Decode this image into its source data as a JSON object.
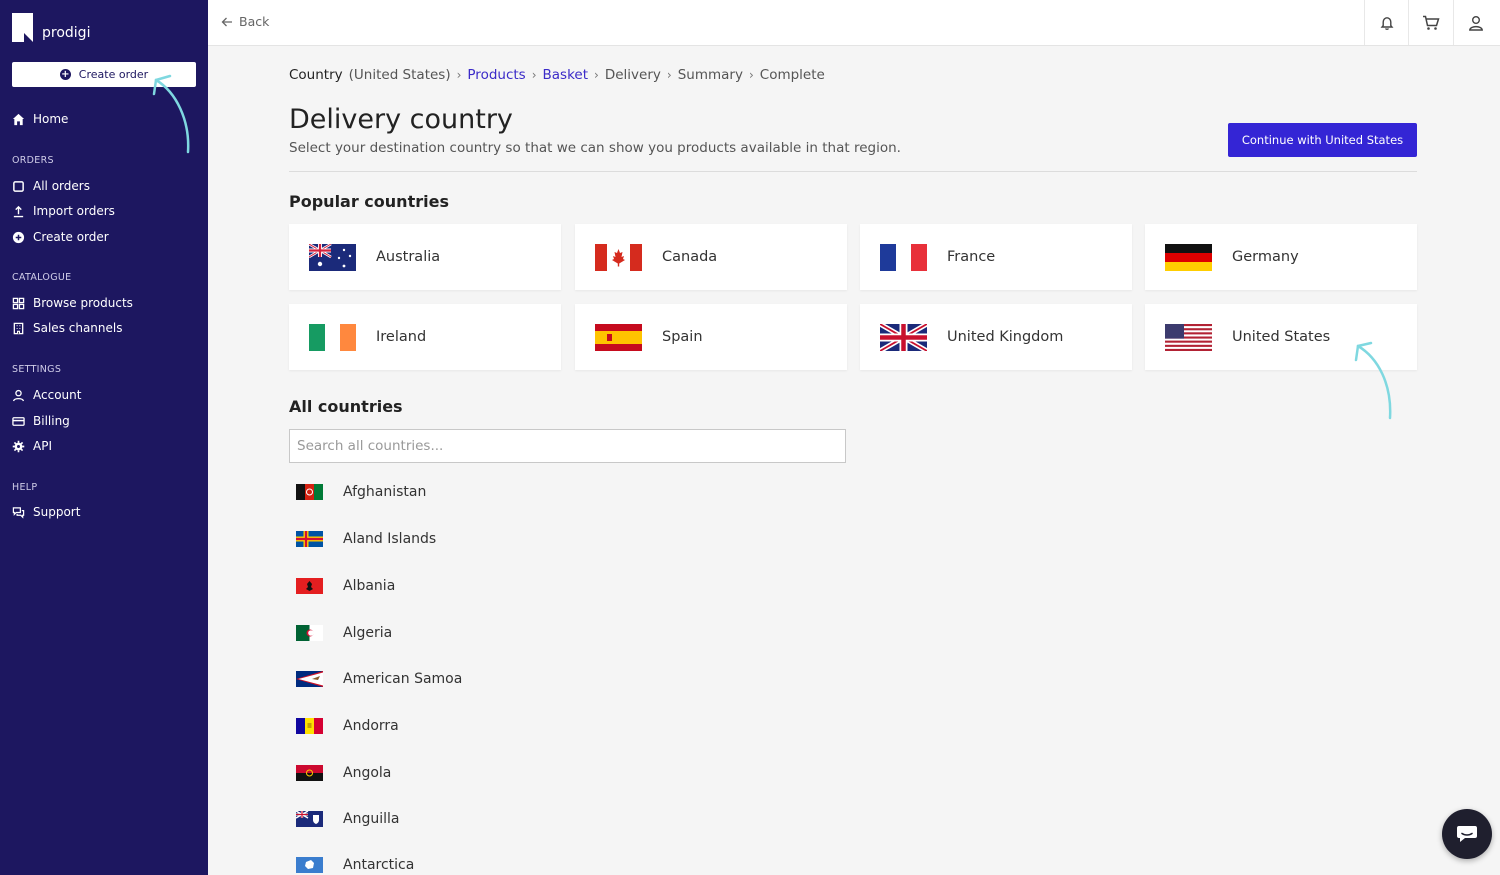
{
  "brand": {
    "name": "prodigi"
  },
  "sidebar": {
    "create_order_label": "Create order",
    "home_label": "Home",
    "sections": {
      "orders": "ORDERS",
      "catalogue": "CATALOGUE",
      "settings": "SETTINGS",
      "help": "HELP"
    },
    "orders_items": [
      "All orders",
      "Import orders",
      "Create order"
    ],
    "catalogue_items": [
      "Browse products",
      "Sales channels"
    ],
    "settings_items": [
      "Account",
      "Billing",
      "API"
    ],
    "help_items": [
      "Support"
    ]
  },
  "topbar": {
    "back_label": "Back"
  },
  "breadcrumb": {
    "current": "Country",
    "current_detail": "(United States)",
    "steps": [
      "Products",
      "Basket",
      "Delivery",
      "Summary",
      "Complete"
    ]
  },
  "page": {
    "title": "Delivery country",
    "subtitle": "Select your destination country so that we can show you products available in that region.",
    "continue_label": "Continue with United States",
    "popular_title": "Popular countries",
    "all_title": "All countries",
    "search_placeholder": "Search all countries..."
  },
  "popular_countries": [
    "Australia",
    "Canada",
    "France",
    "Germany",
    "Ireland",
    "Spain",
    "United Kingdom",
    "United States"
  ],
  "all_countries": [
    "Afghanistan",
    "Aland Islands",
    "Albania",
    "Algeria",
    "American Samoa",
    "Andorra",
    "Angola",
    "Anguilla",
    "Antarctica"
  ],
  "colors": {
    "sidebar_bg": "#1d1760",
    "accent": "#3425d5",
    "link": "#3b2bc8",
    "annotation": "#7fd8e0"
  }
}
